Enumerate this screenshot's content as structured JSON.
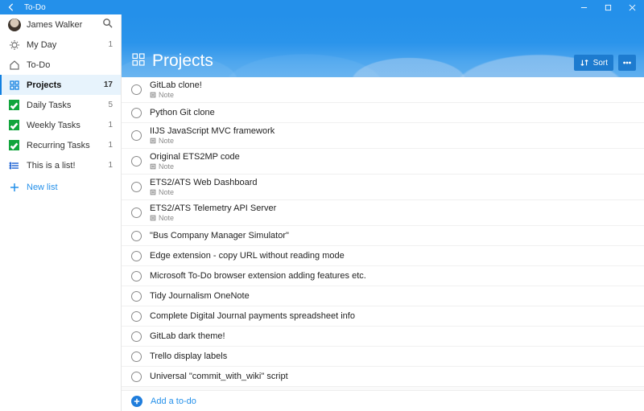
{
  "window": {
    "title": "To-Do"
  },
  "profile": {
    "name": "James Walker"
  },
  "sidebar": {
    "items": [
      {
        "id": "my-day",
        "label": "My Day",
        "count": "1",
        "icon": "sun"
      },
      {
        "id": "todo",
        "label": "To-Do",
        "count": "",
        "icon": "home"
      },
      {
        "id": "projects",
        "label": "Projects",
        "count": "17",
        "icon": "grid",
        "selected": true
      },
      {
        "id": "daily-tasks",
        "label": "Daily Tasks",
        "count": "5",
        "icon": "green-check"
      },
      {
        "id": "weekly-tasks",
        "label": "Weekly Tasks",
        "count": "1",
        "icon": "green-check"
      },
      {
        "id": "recurring-tasks",
        "label": "Recurring Tasks",
        "count": "1",
        "icon": "green-check"
      },
      {
        "id": "this-is-a-list",
        "label": "This is a list!",
        "count": "1",
        "icon": "list"
      }
    ],
    "new_list_label": "New list"
  },
  "header": {
    "title": "Projects",
    "sort_label": "Sort"
  },
  "tasks": [
    {
      "title": "GitLab clone!",
      "note": "Note"
    },
    {
      "title": "Python Git clone"
    },
    {
      "title": "IIJS JavaScript MVC framework",
      "note": "Note"
    },
    {
      "title": "Original ETS2MP code",
      "note": "Note"
    },
    {
      "title": "ETS2/ATS Web Dashboard",
      "note": "Note"
    },
    {
      "title": "ETS2/ATS Telemetry API Server",
      "note": "Note"
    },
    {
      "title": "\"Bus Company Manager Simulator\""
    },
    {
      "title": "Edge extension - copy URL without reading mode"
    },
    {
      "title": "Microsoft To-Do browser extension adding features etc."
    },
    {
      "title": "Tidy Journalism OneNote"
    },
    {
      "title": "Complete Digital Journal payments spreadsheet info"
    },
    {
      "title": "GitLab dark theme!"
    },
    {
      "title": "Trello display labels"
    },
    {
      "title": "Universal \"commit_with_wiki\" script"
    }
  ],
  "add_task": {
    "placeholder": "Add a to-do"
  }
}
